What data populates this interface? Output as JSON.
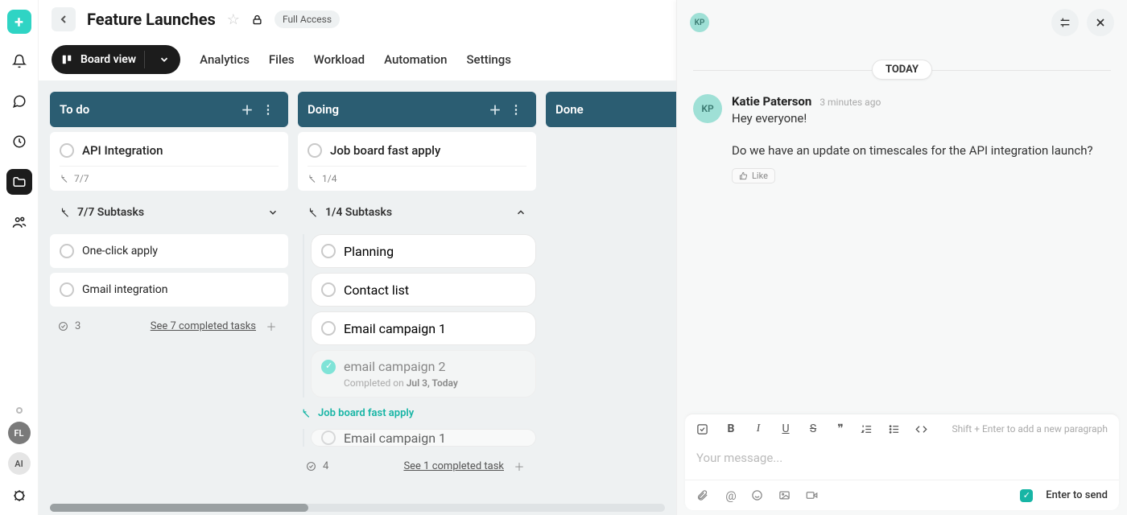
{
  "header": {
    "title": "Feature Launches",
    "access_pill": "Full Access"
  },
  "toolbar": {
    "view_label": "Board view",
    "tabs": [
      "Analytics",
      "Files",
      "Workload",
      "Automation",
      "Settings"
    ]
  },
  "rail": {
    "avatars": [
      {
        "initials": "FL",
        "style": "fl"
      },
      {
        "initials": "AI",
        "style": "ai"
      }
    ]
  },
  "board": {
    "columns": [
      {
        "title": "To do",
        "card": {
          "title": "API Integration",
          "meta": "7/7"
        },
        "subtasks_label": "7/7 Subtasks",
        "subtasks_expanded": false,
        "thin_items": [
          {
            "title": "One-click apply"
          },
          {
            "title": "Gmail integration"
          }
        ],
        "footer": {
          "count": "3",
          "see": "See 7 completed tasks"
        }
      },
      {
        "title": "Doing",
        "card": {
          "title": "Job board fast apply",
          "meta": "1/4"
        },
        "subtasks_label": "1/4 Subtasks",
        "subtasks_expanded": true,
        "subtasks": [
          {
            "title": "Planning",
            "done": false
          },
          {
            "title": "Contact list",
            "done": false
          },
          {
            "title": "Email campaign 1",
            "done": false
          },
          {
            "title": "email campaign 2",
            "done": true,
            "completed_prefix": "Completed on ",
            "completed_date": "Jul 3, Today"
          }
        ],
        "link_row": "Job board fast apply",
        "peek_sub": "Email campaign 1",
        "footer": {
          "count": "4",
          "see": "See 1 completed task"
        }
      },
      {
        "title": "Done"
      }
    ]
  },
  "chat": {
    "header_initials": "KP",
    "day_label": "TODAY",
    "message": {
      "initials": "KP",
      "name": "Katie Paterson",
      "time": "3 minutes ago",
      "line1": "Hey everyone!",
      "line2": "Do we have an update on timescales for the API integration launch?",
      "like_label": "Like"
    },
    "composer": {
      "hint": "Shift + Enter to add a new paragraph",
      "placeholder": "Your message...",
      "send_label": "Enter to send"
    }
  }
}
